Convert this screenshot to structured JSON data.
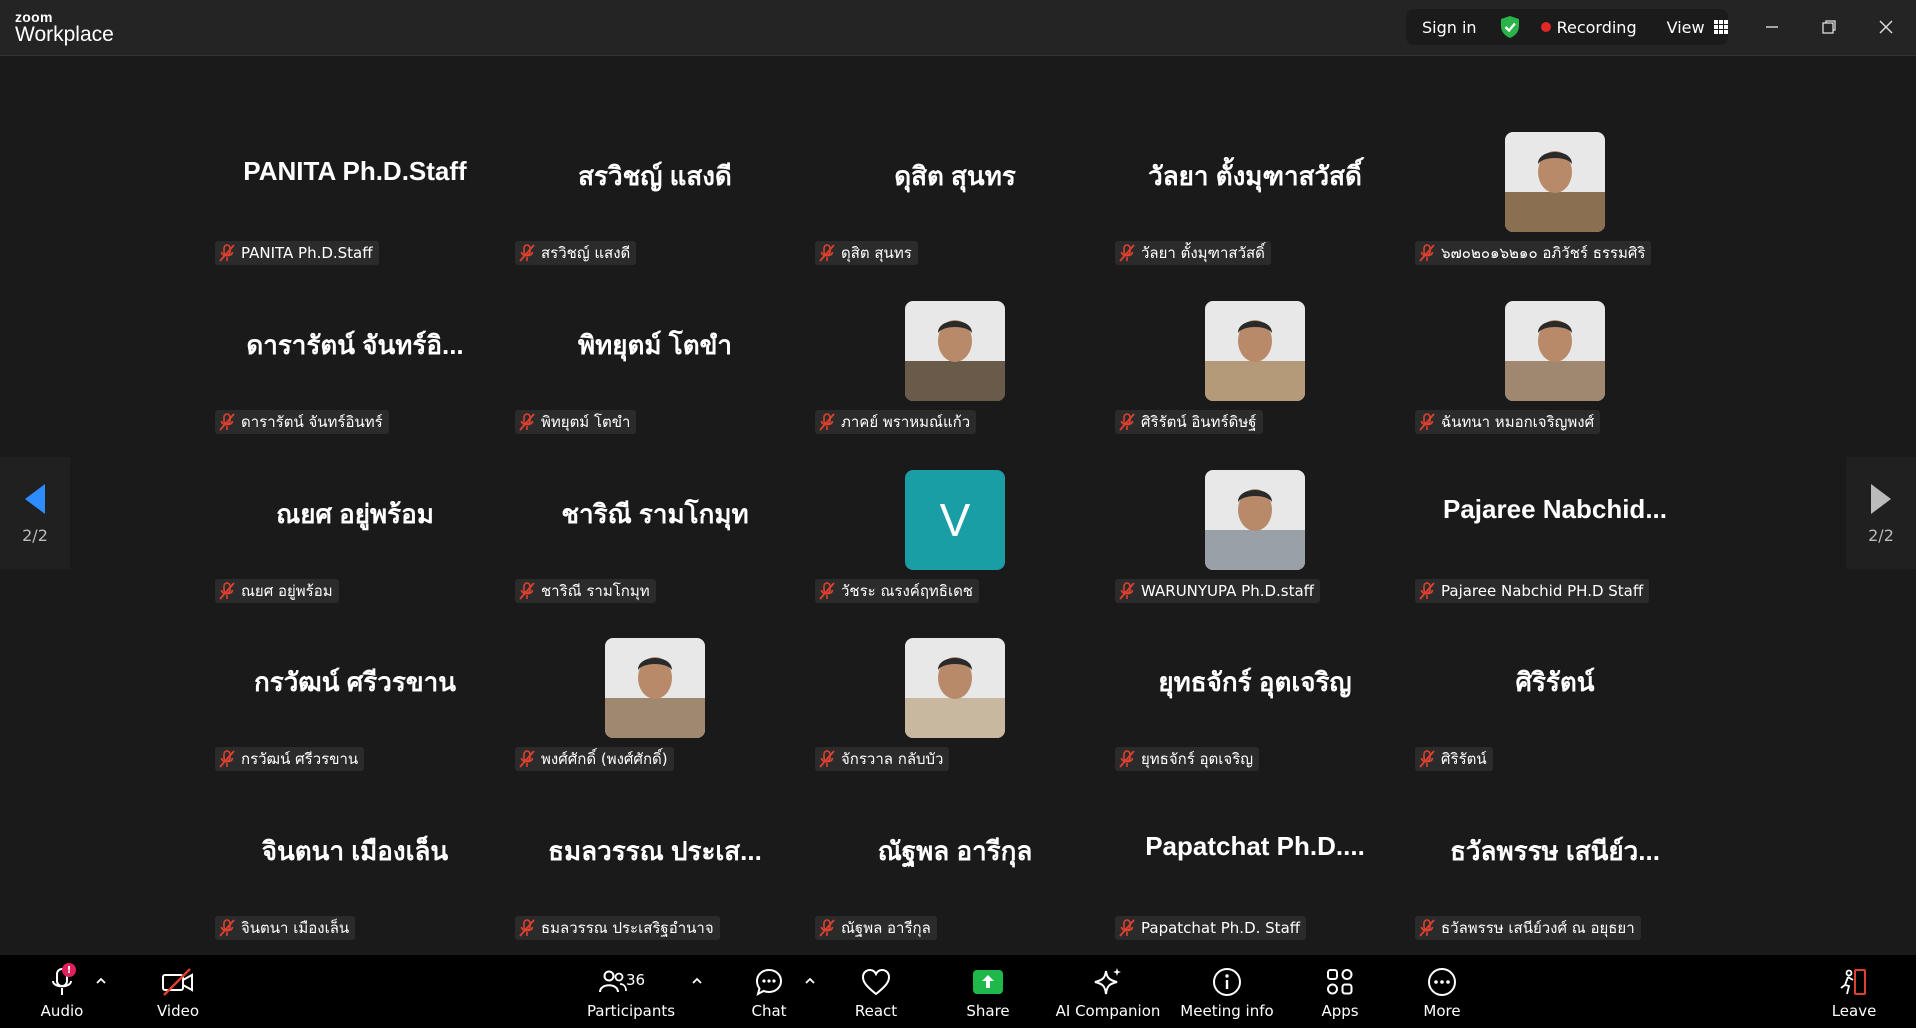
{
  "app": {
    "brand_top": "zoom",
    "brand_bottom": "Workplace"
  },
  "header": {
    "sign_in": "Sign in",
    "recording": "Recording",
    "view": "View"
  },
  "pager": {
    "label": "2/2"
  },
  "tiles": [
    {
      "big": "PANITA Ph.D.Staff",
      "name": "PANITA Ph.D.Staff",
      "avatar": ""
    },
    {
      "big": "สรวิชญ์ แสงดี",
      "name": "สรวิชญ์ แสงดี",
      "avatar": ""
    },
    {
      "big": "ดุสิต สุนทร",
      "name": "ดุสิต สุนทร",
      "avatar": ""
    },
    {
      "big": "วัลยา ตั้งมุฑาสวัสดิ์",
      "name": "วัลยา ตั้งมุฑาสวัสดิ์",
      "avatar": ""
    },
    {
      "big": "",
      "name": "๖๗๐๒๐๑๖๒๑๐ อภิวัชร์ ธรรมศิริ",
      "avatar": "photo"
    },
    {
      "big": "ดารารัตน์ จันทร์อิ...",
      "name": "ดารารัตน์ จันทร์อินทร์",
      "avatar": ""
    },
    {
      "big": "พิทยุตม์ โตขำ",
      "name": "พิทยุตม์ โตขำ",
      "avatar": ""
    },
    {
      "big": "",
      "name": "ภาคย์ พราหมณ์แก้ว",
      "avatar": "photo"
    },
    {
      "big": "",
      "name": "ศิริรัตน์ อินทร์ดิษฐ์",
      "avatar": "photo"
    },
    {
      "big": "",
      "name": "ฉันทนา หมอกเจริญพงศ์",
      "avatar": "photo"
    },
    {
      "big": "ณยศ อยู่พร้อม",
      "name": "ณยศ อยู่พร้อม",
      "avatar": ""
    },
    {
      "big": "ชาริณี รามโกมุท",
      "name": "ชาริณี รามโกมุท",
      "avatar": ""
    },
    {
      "big": "",
      "name": "วัชระ ณรงค์ฤทธิเดช",
      "avatar": "letter",
      "letter": "V"
    },
    {
      "big": "",
      "name": "WARUNYUPA Ph.D.staff",
      "avatar": "photo"
    },
    {
      "big": "Pajaree Nabchid...",
      "name": "Pajaree Nabchid PH.D Staff",
      "avatar": ""
    },
    {
      "big": "กรวัฒน์ ศรีวรขาน",
      "name": "กรวัฒน์ ศรีวรขาน",
      "avatar": ""
    },
    {
      "big": "",
      "name": "พงศ์ศักดิ์ (พงศ์ศักดิ์)",
      "avatar": "photo"
    },
    {
      "big": "",
      "name": "จักรวาล กลับบัว",
      "avatar": "photo"
    },
    {
      "big": "ยุทธจักร์ อุตเจริญ",
      "name": "ยุทธจักร์ อุตเจริญ",
      "avatar": ""
    },
    {
      "big": "ศิริรัตน์",
      "name": "ศิริรัตน์",
      "avatar": ""
    },
    {
      "big": "จินตนา เมืองเล็น",
      "name": "จินตนา เมืองเล็น",
      "avatar": ""
    },
    {
      "big": "ธมลวรรณ ประเส...",
      "name": "ธมลวรรณ ประเสริฐอำนาจ",
      "avatar": ""
    },
    {
      "big": "ณัฐพล อารีกุล",
      "name": "ณัฐพล อารีกุล",
      "avatar": ""
    },
    {
      "big": "Papatchat Ph.D....",
      "name": "Papatchat Ph.D. Staff",
      "avatar": ""
    },
    {
      "big": "ธวัลพรรษ เสนีย์ว...",
      "name": "ธวัลพรรษ เสนีย์วงศ์ ณ อยุธยา",
      "avatar": ""
    }
  ],
  "toolbar": {
    "audio": "Audio",
    "audio_badge": "!",
    "video": "Video",
    "participants": "Participants",
    "participants_count": "36",
    "chat": "Chat",
    "react": "React",
    "share": "Share",
    "ai_companion": "AI Companion",
    "meeting_info": "Meeting info",
    "apps": "Apps",
    "more": "More",
    "leave": "Leave"
  },
  "colors": {
    "share_green": "#1fb84b",
    "letter_avatar": "#1a9ea6",
    "mute_red": "#e0402e",
    "shield_green": "#29b34a"
  }
}
